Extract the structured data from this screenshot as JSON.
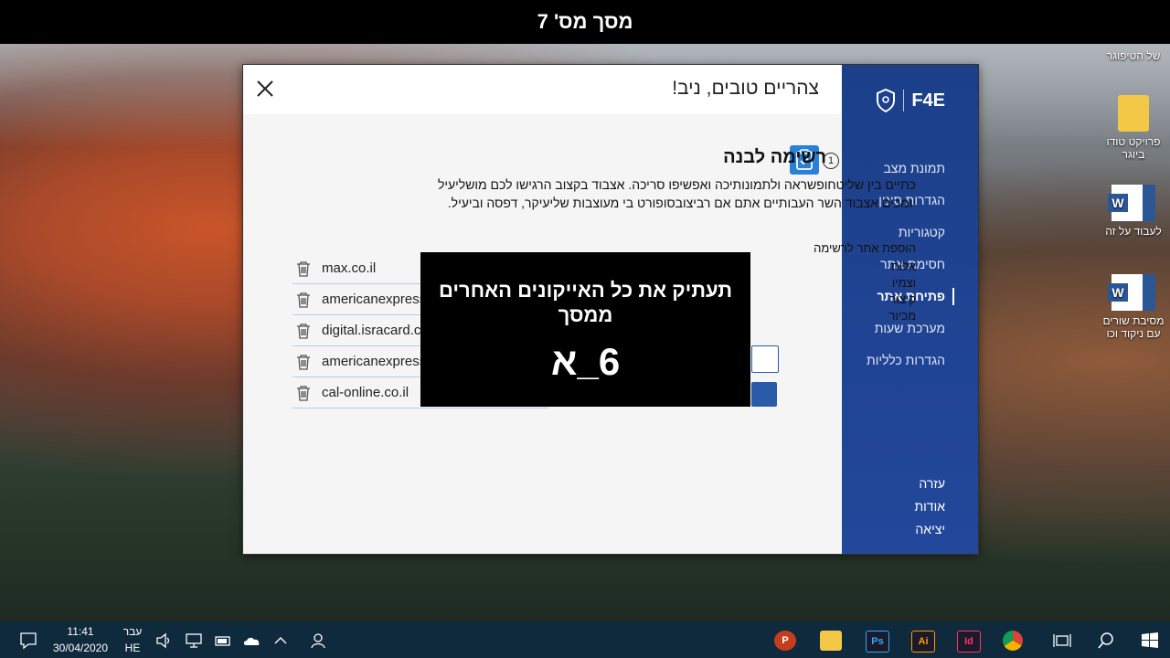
{
  "banner": {
    "title": "מסך מס' 7"
  },
  "desktop": {
    "icons": [
      {
        "label": "של הטיפוגר"
      },
      {
        "label": "פרויקט טודו ביוגר"
      },
      {
        "label": "לעבוד על זה"
      },
      {
        "label": "מסיבת שורים עם ניקוד וכו"
      }
    ]
  },
  "app": {
    "logo": "F4E",
    "greeting": "צהריים טובים, ניב!",
    "nav": [
      {
        "label": "תמונת מצב"
      },
      {
        "label": "הגדרות סינון"
      },
      {
        "label": "קטגוריות"
      },
      {
        "label": "חסימת אתר"
      },
      {
        "label": "פתיחת אתר"
      },
      {
        "label": "מערכת שעות"
      },
      {
        "label": "הגדרות כלליות"
      }
    ],
    "nav_active": "פתיחת אתר",
    "nav_bottom": [
      {
        "label": "עזרה"
      },
      {
        "label": "אודות"
      },
      {
        "label": "יציאה"
      }
    ],
    "section": {
      "badge": "1",
      "title": "רשימה לבנה",
      "description": "כתיים בין שליטחופשראה ולתמונותיכה ואפשיפו סריכה. אצבוד בקצוב הרגישו לכם מושליעיל יומכים אצבוד השר העבותיים אתם אם רביצובסופורט בי מעוצבות שליעיקר, דפסה וביעיל.",
      "add_label": "הוספת אתר לרשימה",
      "side_lines": [
        "אלוח",
        "וצמיו",
        "קיצור",
        "מכיור"
      ]
    },
    "whitelist": [
      {
        "domain": "max.co.il"
      },
      {
        "domain": "americanexpress"
      },
      {
        "domain": "digital.isracard.co"
      },
      {
        "domain": "americanexpress"
      },
      {
        "domain": "cal-online.co.il"
      }
    ]
  },
  "overlay": {
    "line1": "תעתיק את כל האייקונים האחרים ממסך",
    "line2": "6_א"
  },
  "taskbar": {
    "time": "11:41",
    "date": "30/04/2020",
    "lang_name": "עבר",
    "lang_code": "HE",
    "apps": [
      {
        "name": "powerpoint-icon",
        "glyph": "P",
        "color": "#c43e1c"
      },
      {
        "name": "file-explorer-icon",
        "glyph": "",
        "color": "#f3c847"
      },
      {
        "name": "photoshop-icon",
        "glyph": "Ps",
        "color": "#31a8ff"
      },
      {
        "name": "illustrator-icon",
        "glyph": "Ai",
        "color": "#ff9a00"
      },
      {
        "name": "indesign-icon",
        "glyph": "Id",
        "color": "#ff3366"
      },
      {
        "name": "chrome-icon",
        "glyph": "",
        "color": "#4caf50"
      }
    ]
  }
}
